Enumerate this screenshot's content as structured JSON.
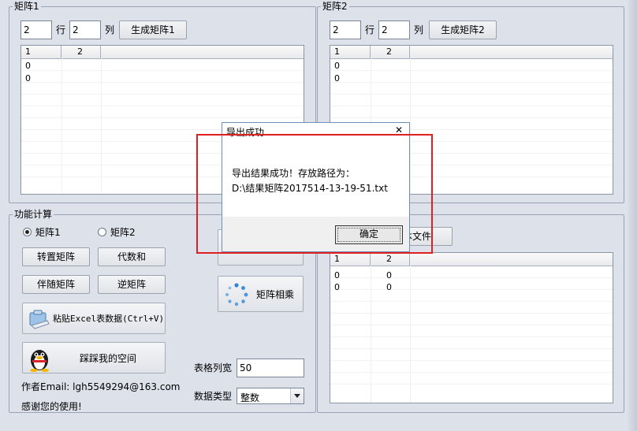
{
  "matrix1": {
    "group_label": "矩阵1",
    "rows_value": "2",
    "rows_label": "行",
    "cols_value": "2",
    "cols_label": "列",
    "generate_button": "生成矩阵1",
    "columns": [
      "1",
      "2"
    ],
    "cells": [
      [
        "0",
        ""
      ],
      [
        "0",
        ""
      ]
    ]
  },
  "matrix2": {
    "group_label": "矩阵2",
    "rows_value": "2",
    "rows_label": "行",
    "cols_value": "2",
    "cols_label": "列",
    "generate_button": "生成矩阵2",
    "columns": [
      "1",
      "2"
    ],
    "cells": [
      [
        "0",
        ""
      ],
      [
        "0",
        ""
      ]
    ]
  },
  "functions": {
    "group_label": "功能计算",
    "radio1": "矩阵1",
    "radio2": "矩阵2",
    "selected": "矩阵1",
    "transpose": "转置矩阵",
    "algebraic_cofactor": "代数和",
    "adjoint": "伴随矩阵",
    "inverse": "逆矩阵",
    "paste_excel": "粘贴Excel表数据(Ctrl+V)",
    "visit_space": "踩踩我的空间",
    "multiply": "矩阵相乘",
    "author_email": "作者Email: lgh5549294@163.com",
    "thanks": "感谢您的使用!",
    "col_width_label": "表格列宽",
    "col_width_value": "50",
    "data_type_label": "数据类型",
    "data_type_value": "整数"
  },
  "result": {
    "export_button_partial": "本文件",
    "columns": [
      "1",
      "2"
    ],
    "cells": [
      [
        "0",
        "0"
      ],
      [
        "0",
        "0"
      ]
    ]
  },
  "dialog": {
    "title": "导出成功",
    "message_line1": "导出结果成功！存放路径为：",
    "message_line2": "D:\\结果矩阵2017514-13-19-51.txt",
    "ok_button": "确定",
    "close_glyph": "✕"
  }
}
